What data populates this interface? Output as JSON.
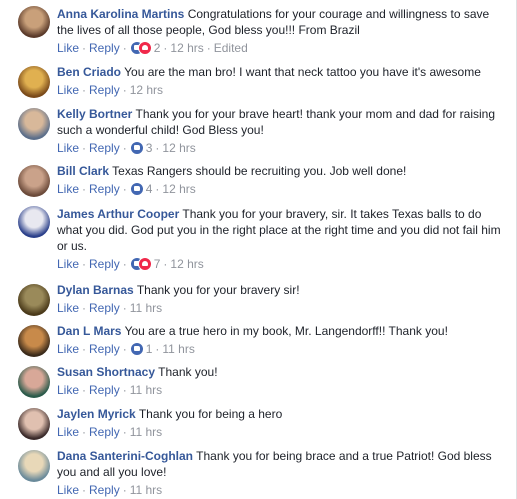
{
  "comments": [
    {
      "name": "Anna Karolina Martins",
      "text": "Congratulations for your courage and willingness to save the lives of all those people, God bless you!!! From Brazil",
      "like": "Like",
      "reply": "Reply",
      "reactions": [
        "like",
        "love"
      ],
      "reaction_count": "2",
      "time": "12 hrs",
      "edited": "Edited",
      "avatar_colors": [
        "#5a3a2a",
        "#c9a07a"
      ]
    },
    {
      "name": "Ben Criado",
      "text": "You are the man bro! I want that neck tattoo you have it's awesome",
      "like": "Like",
      "reply": "Reply",
      "time": "12 hrs",
      "avatar_colors": [
        "#7a4a1a",
        "#e0b050"
      ]
    },
    {
      "name": "Kelly Bortner",
      "text": "Thank you for your brave heart! thank your mom and dad for raising such a wonderful child! God Bless you!",
      "like": "Like",
      "reply": "Reply",
      "reactions": [
        "like"
      ],
      "reaction_count": "3",
      "time": "12 hrs",
      "avatar_colors": [
        "#5b6e8a",
        "#d8b89a"
      ]
    },
    {
      "name": "Bill Clark",
      "text": "Texas Rangers should be recruiting you. Job well done!",
      "like": "Like",
      "reply": "Reply",
      "reactions": [
        "like"
      ],
      "reaction_count": "4",
      "time": "12 hrs",
      "avatar_colors": [
        "#6b4a3a",
        "#caa28a"
      ]
    },
    {
      "name": "James Arthur Cooper",
      "text": "Thank you for your bravery, sir. It takes Texas balls to do what you did. God put you in the right place at the right time and you did not fail him or us.",
      "like": "Like",
      "reply": "Reply",
      "reactions": [
        "like",
        "love"
      ],
      "reaction_count": "7",
      "time": "12 hrs",
      "avatar_colors": [
        "#2a3f8a",
        "#e8e8f0"
      ]
    },
    {
      "name": "Dylan Barnas",
      "text": "Thank you for your bravery sir!",
      "like": "Like",
      "reply": "Reply",
      "time": "11 hrs",
      "avatar_colors": [
        "#4a3a1a",
        "#9a8a5a"
      ]
    },
    {
      "name": "Dan L Mars",
      "text": "You are a true hero in my book, Mr. Langendorff!! Thank you!",
      "like": "Like",
      "reply": "Reply",
      "reactions": [
        "like"
      ],
      "reaction_count": "1",
      "time": "11 hrs",
      "avatar_colors": [
        "#3a2a1a",
        "#c88a4a"
      ]
    },
    {
      "name": "Susan Shortnacy",
      "text": "Thank you!",
      "like": "Like",
      "reply": "Reply",
      "time": "11 hrs",
      "avatar_colors": [
        "#2a5a4a",
        "#d8a898"
      ]
    },
    {
      "name": "Jaylen Myrick",
      "text": "Thank you for being a hero",
      "like": "Like",
      "reply": "Reply",
      "time": "11 hrs",
      "avatar_colors": [
        "#3a2a2a",
        "#e0c0b0"
      ]
    },
    {
      "name": "Dana Santerini-Coghlan",
      "text": "Thank you for being brace and a true Patriot! God bless you and all you love!",
      "like": "Like",
      "reply": "Reply",
      "time": "11 hrs",
      "avatar_colors": [
        "#6a8a9a",
        "#e8d8b8"
      ]
    }
  ],
  "colors": {
    "name": "#365899",
    "link": "#4267b2",
    "meta": "#90949c",
    "text": "#1d2129",
    "like_reaction": "#4267b2",
    "love_reaction": "#f0284a"
  }
}
